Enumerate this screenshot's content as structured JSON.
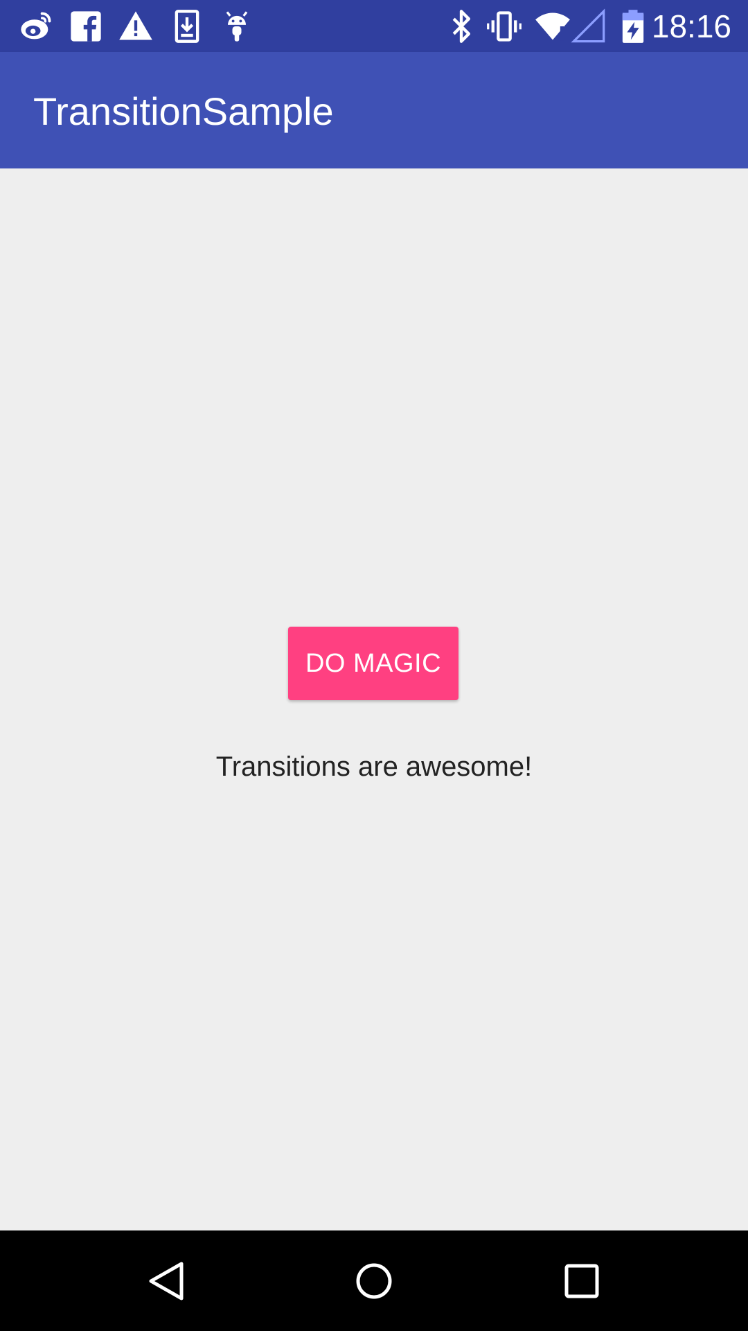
{
  "status_bar": {
    "time": "18:16",
    "left_icons": [
      "weibo-icon",
      "facebook-icon",
      "warning-icon",
      "download-icon",
      "android-icon"
    ],
    "right_icons": [
      "bluetooth-icon",
      "vibrate-icon",
      "wifi-icon",
      "signal-icon",
      "battery-icon"
    ],
    "color": "#303F9F"
  },
  "app_bar": {
    "title": "TransitionSample",
    "color": "#3F51B5"
  },
  "main": {
    "button_label": "DO MAGIC",
    "button_color": "#FF4081",
    "message": "Transitions are awesome!"
  },
  "nav_bar": {
    "buttons": [
      "back-icon",
      "home-icon",
      "recents-icon"
    ]
  }
}
